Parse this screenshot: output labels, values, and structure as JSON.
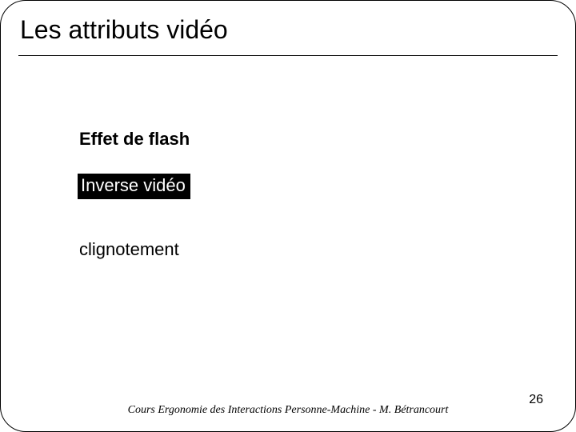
{
  "slide": {
    "title": "Les attributs vidéo",
    "items": {
      "flash": "Effet de flash",
      "inverse": "Inverse vidéo",
      "blink": "clignotement"
    },
    "footer": "Cours Ergonomie des Interactions Personne-Machine - M. Bétrancourt",
    "page": "26"
  }
}
